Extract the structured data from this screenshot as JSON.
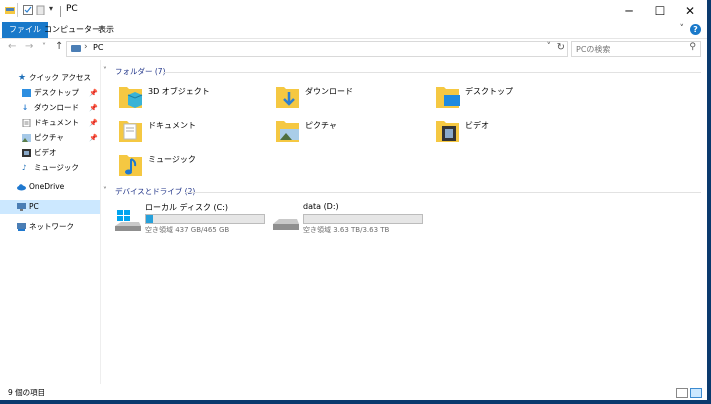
{
  "window": {
    "title": "PC",
    "controls": {
      "minimize": "─",
      "maximize": "☐",
      "close": "✕"
    }
  },
  "ribbon": {
    "tabs": [
      "ファイル",
      "コンピューター",
      "表示"
    ],
    "help": "?",
    "collapse": "˅"
  },
  "nav": {
    "back": "←",
    "forward": "→",
    "recent": "˅",
    "up": "↑",
    "address": "PC",
    "search_placeholder": "PCの検索"
  },
  "sidebar": {
    "items": [
      {
        "label": "クイック アクセス",
        "icon": "star-icon"
      },
      {
        "label": "デスクトップ",
        "icon": "desktop-icon",
        "pinned": true
      },
      {
        "label": "ダウンロード",
        "icon": "download-icon",
        "pinned": true
      },
      {
        "label": "ドキュメント",
        "icon": "document-icon",
        "pinned": true
      },
      {
        "label": "ピクチャ",
        "icon": "pictures-icon",
        "pinned": true
      },
      {
        "label": "ビデオ",
        "icon": "video-icon"
      },
      {
        "label": "ミュージック",
        "icon": "music-icon"
      },
      {
        "label": "OneDrive",
        "icon": "cloud-icon"
      },
      {
        "label": "PC",
        "icon": "pc-icon",
        "selected": true
      },
      {
        "label": "ネットワーク",
        "icon": "network-icon"
      }
    ]
  },
  "content": {
    "folders_header": "フォルダー (7)",
    "folders": [
      {
        "label": "3D オブジェクト",
        "icon": "3d-objects-icon"
      },
      {
        "label": "ダウンロード",
        "icon": "download-folder-icon"
      },
      {
        "label": "デスクトップ",
        "icon": "desktop-folder-icon"
      },
      {
        "label": "ドキュメント",
        "icon": "documents-folder-icon"
      },
      {
        "label": "ピクチャ",
        "icon": "pictures-folder-icon"
      },
      {
        "label": "ビデオ",
        "icon": "videos-folder-icon"
      },
      {
        "label": "ミュージック",
        "icon": "music-folder-icon"
      }
    ],
    "drives_header": "デバイスとドライブ (2)",
    "drives": [
      {
        "name": "ローカル ディスク (C:)",
        "free": "空き領域 437 GB/465 GB",
        "used_fraction": 0.06,
        "icon": "windows-drive-icon"
      },
      {
        "name": "data (D:)",
        "free": "空き領域 3.63 TB/3.63 TB",
        "used_fraction": 0.0,
        "icon": "drive-icon"
      }
    ]
  },
  "status": {
    "item_count": "9 個の項目"
  },
  "colors": {
    "accent": "#1979ca",
    "selection": "#cce8ff",
    "folder": "#f5c842",
    "drive_fill": "#26a0da",
    "header_text": "#1e3287"
  }
}
